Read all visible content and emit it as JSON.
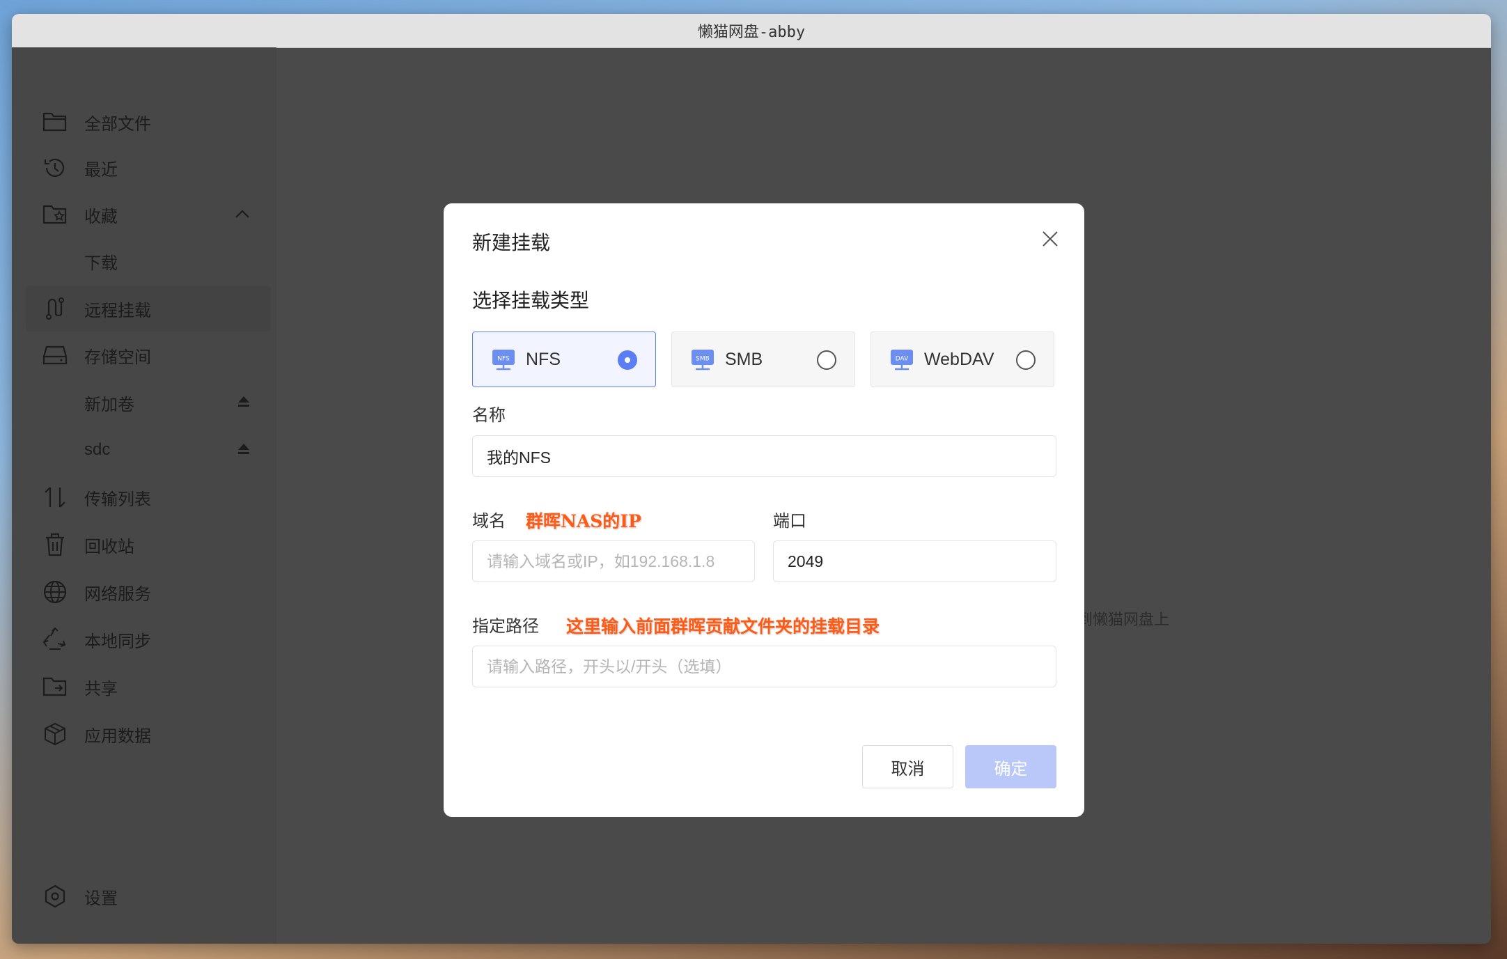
{
  "window": {
    "title": "懒猫网盘-abby"
  },
  "sidebar": {
    "items": [
      {
        "label": "全部文件"
      },
      {
        "label": "最近"
      },
      {
        "label": "收藏"
      },
      {
        "label": "下载"
      },
      {
        "label": "远程挂载"
      },
      {
        "label": "存储空间"
      },
      {
        "label": "新加卷"
      },
      {
        "label": "sdc"
      },
      {
        "label": "传输列表"
      },
      {
        "label": "回收站"
      },
      {
        "label": "网络服务"
      },
      {
        "label": "本地同步"
      },
      {
        "label": "共享"
      },
      {
        "label": "应用数据"
      },
      {
        "label": "设置"
      }
    ]
  },
  "background": {
    "hint_text": "到懒猫网盘上"
  },
  "dialog": {
    "title": "新建挂载",
    "section_title": "选择挂载类型",
    "types": [
      {
        "label": "NFS",
        "badge": "NFS",
        "selected": true
      },
      {
        "label": "SMB",
        "badge": "SMB",
        "selected": false
      },
      {
        "label": "WebDAV",
        "badge": "DAV",
        "selected": false
      }
    ],
    "name_label": "名称",
    "name_value": "我的NFS",
    "domain_label": "域名",
    "domain_annotation": "群晖NAS的IP",
    "domain_placeholder": "请输入域名或IP，如192.168.1.8",
    "port_label": "端口",
    "port_value": "2049",
    "path_label": "指定路径",
    "path_annotation": "这里输入前面群晖贡献文件夹的挂载目录",
    "path_placeholder": "请输入路径，开头以/开头（选填）",
    "cancel_label": "取消",
    "confirm_label": "确定"
  },
  "colors": {
    "accent": "#5b7ef5",
    "confirm_disabled": "#b9c7f9",
    "annotation": "#ff5b14"
  }
}
